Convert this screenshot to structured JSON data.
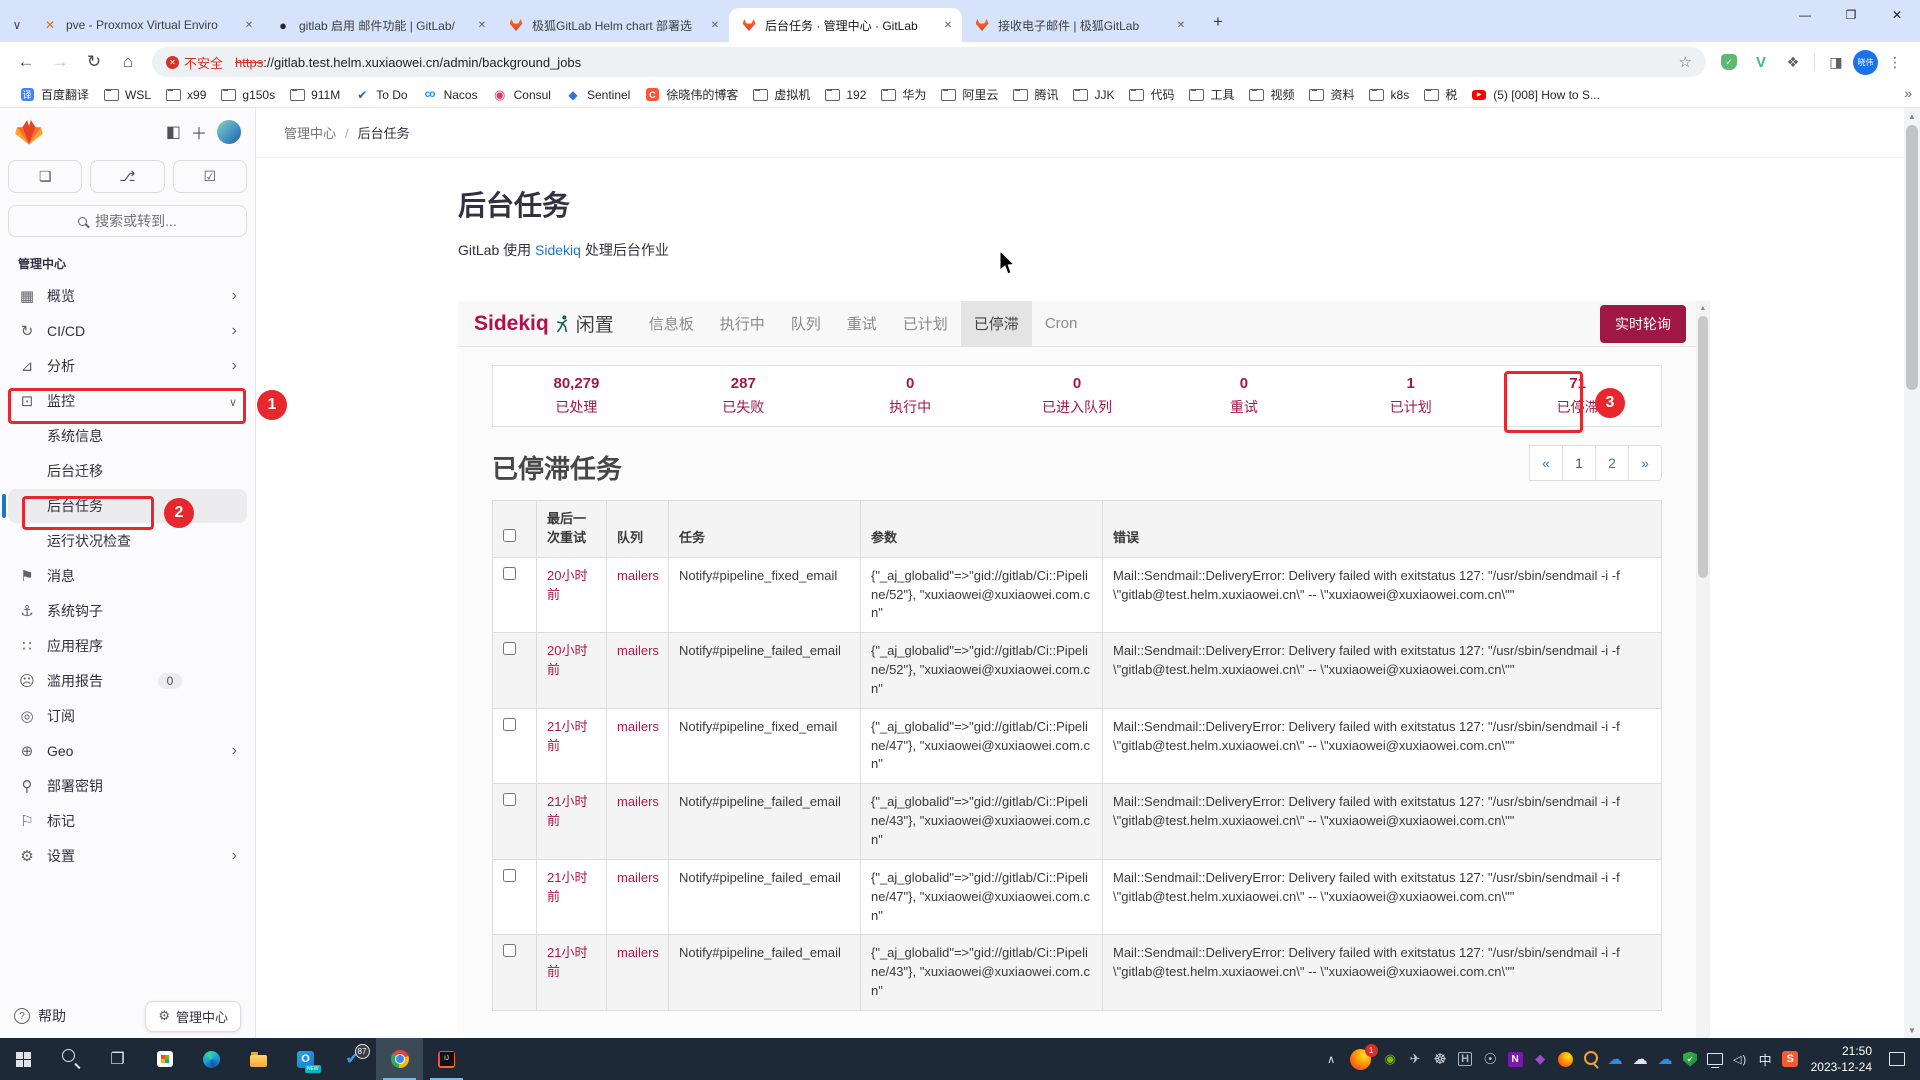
{
  "browser": {
    "tabs": [
      {
        "icon": "proxmox",
        "title": "pve - Proxmox Virtual Enviro"
      },
      {
        "icon": "github",
        "title": "gitlab 启用 邮件功能 | GitLab/"
      },
      {
        "icon": "fox",
        "title": "极狐GitLab Helm chart 部署选"
      },
      {
        "icon": "fox",
        "title": "后台任务 · 管理中心 · GitLab",
        "active": true
      },
      {
        "icon": "fox",
        "title": "接收电子邮件 | 极狐GitLab"
      }
    ],
    "window": {
      "minimize": "—",
      "maximize": "❐",
      "close": "✕"
    },
    "toolbar": {
      "back": "←",
      "forward": "→",
      "reload": "↻",
      "home": "⌂",
      "security_label": "不安全",
      "url_https": "https",
      "url_rest": "://gitlab.test.helm.xuxiaowei.cn/admin/background_jobs",
      "star": "☆",
      "extensions": "❖",
      "kebab": "⋮",
      "avatar_text": "晓伟",
      "vue": "V",
      "side_panel": "◨"
    },
    "bookmarks": [
      {
        "icon": "translate",
        "label": "百度翻译"
      },
      {
        "icon": "folder",
        "label": "WSL"
      },
      {
        "icon": "folder",
        "label": "x99"
      },
      {
        "icon": "folder",
        "label": "g150s"
      },
      {
        "icon": "folder",
        "label": "911M"
      },
      {
        "icon": "todo",
        "label": "To Do"
      },
      {
        "icon": "nacos",
        "label": "Nacos"
      },
      {
        "icon": "consul",
        "label": "Consul"
      },
      {
        "icon": "sentinel",
        "label": "Sentinel"
      },
      {
        "icon": "csdn",
        "label": "徐晓伟的博客"
      },
      {
        "icon": "folder",
        "label": "虚拟机"
      },
      {
        "icon": "folder",
        "label": "192"
      },
      {
        "icon": "folder",
        "label": "华为"
      },
      {
        "icon": "folder",
        "label": "阿里云"
      },
      {
        "icon": "folder",
        "label": "腾讯"
      },
      {
        "icon": "folder",
        "label": "JJK"
      },
      {
        "icon": "folder",
        "label": "代码"
      },
      {
        "icon": "folder",
        "label": "工具"
      },
      {
        "icon": "folder",
        "label": "视频"
      },
      {
        "icon": "folder",
        "label": "资料"
      },
      {
        "icon": "folder",
        "label": "k8s"
      },
      {
        "icon": "folder",
        "label": "税"
      },
      {
        "icon": "youtube",
        "label": "(5) [008] How to S..."
      }
    ],
    "bookmarks_overflow": "»"
  },
  "sidebar": {
    "search_placeholder": "搜索或转到...",
    "section_label": "管理中心",
    "items": [
      {
        "icon": "overview",
        "label": "概览",
        "trailing": "chevron-right"
      },
      {
        "icon": "cicd",
        "label": "CI/CD",
        "trailing": "chevron-right"
      },
      {
        "icon": "analytics",
        "label": "分析",
        "trailing": "chevron-right"
      },
      {
        "icon": "monitoring",
        "label": "监控",
        "trailing": "chevron-down"
      },
      {
        "label": "系统信息",
        "sub": true
      },
      {
        "label": "后台迁移",
        "sub": true
      },
      {
        "label": "后台任务",
        "sub": true,
        "active": true
      },
      {
        "label": "运行状况检查",
        "sub": true
      },
      {
        "icon": "announcements",
        "label": "消息"
      },
      {
        "icon": "hooks",
        "label": "系统钩子"
      },
      {
        "icon": "applications",
        "label": "应用程序"
      },
      {
        "icon": "abuse",
        "label": "滥用报告",
        "badge": "0"
      },
      {
        "icon": "subscription",
        "label": "订阅"
      },
      {
        "icon": "geo",
        "label": "Geo",
        "trailing": "chevron-right"
      },
      {
        "icon": "deploy-keys",
        "label": "部署密钥"
      },
      {
        "icon": "labels",
        "label": "标记"
      },
      {
        "icon": "settings",
        "label": "设置",
        "trailing": "chevron-right"
      }
    ],
    "footer": {
      "help_label": "帮助",
      "admin_pill_label": "管理中心"
    }
  },
  "page": {
    "breadcrumb": [
      {
        "label": "管理中心"
      },
      {
        "label": "后台任务"
      }
    ],
    "title": "后台任务",
    "subtitle_prefix": "GitLab 使用 ",
    "subtitle_link": "Sidekiq",
    "subtitle_suffix": " 处理后台作业"
  },
  "sidekiq": {
    "brand": "Sidekiq",
    "status": "闲置",
    "tabs": [
      {
        "label": "信息板"
      },
      {
        "label": "执行中"
      },
      {
        "label": "队列"
      },
      {
        "label": "重试"
      },
      {
        "label": "已计划"
      },
      {
        "label": "已停滞",
        "active": true
      },
      {
        "label": "Cron"
      }
    ],
    "poll_button": "实时轮询",
    "stats": [
      {
        "value": "80,279",
        "label": "已处理"
      },
      {
        "value": "287",
        "label": "已失败"
      },
      {
        "value": "0",
        "label": "执行中"
      },
      {
        "value": "0",
        "label": "已进入队列"
      },
      {
        "value": "0",
        "label": "重试"
      },
      {
        "value": "1",
        "label": "已计划"
      },
      {
        "value": "71",
        "label": "已停滞"
      }
    ],
    "dead_title": "已停滞任务",
    "pagination": [
      {
        "label": "«"
      },
      {
        "label": "1",
        "current": true
      },
      {
        "label": "2"
      },
      {
        "label": "»"
      }
    ],
    "table": {
      "headers": [
        {
          "label": "最后一次重试"
        },
        {
          "label": "队列"
        },
        {
          "label": "任务"
        },
        {
          "label": "参数"
        },
        {
          "label": "错误"
        }
      ],
      "rows": [
        {
          "retried": "20小时前",
          "queue": "mailers",
          "job": "Notify#pipeline_fixed_email",
          "args": "{\"_aj_globalid\"=>\"gid://gitlab/Ci::Pipeline/52\"}, \"xuxiaowei@xuxiaowei.com.cn\"",
          "error": "Mail::Sendmail::DeliveryError: Delivery failed with exitstatus 127: \"/usr/sbin/sendmail -i -f \\\"gitlab@test.helm.xuxiaowei.cn\\\" -- \\\"xuxiaowei@xuxiaowei.com.cn\\\"\""
        },
        {
          "retried": "20小时前",
          "queue": "mailers",
          "job": "Notify#pipeline_failed_email",
          "args": "{\"_aj_globalid\"=>\"gid://gitlab/Ci::Pipeline/52\"}, \"xuxiaowei@xuxiaowei.com.cn\"",
          "error": "Mail::Sendmail::DeliveryError: Delivery failed with exitstatus 127: \"/usr/sbin/sendmail -i -f \\\"gitlab@test.helm.xuxiaowei.cn\\\" -- \\\"xuxiaowei@xuxiaowei.com.cn\\\"\""
        },
        {
          "retried": "21小时前",
          "queue": "mailers",
          "job": "Notify#pipeline_fixed_email",
          "args": "{\"_aj_globalid\"=>\"gid://gitlab/Ci::Pipeline/47\"}, \"xuxiaowei@xuxiaowei.com.cn\"",
          "error": "Mail::Sendmail::DeliveryError: Delivery failed with exitstatus 127: \"/usr/sbin/sendmail -i -f \\\"gitlab@test.helm.xuxiaowei.cn\\\" -- \\\"xuxiaowei@xuxiaowei.com.cn\\\"\""
        },
        {
          "retried": "21小时前",
          "queue": "mailers",
          "job": "Notify#pipeline_failed_email",
          "args": "{\"_aj_globalid\"=>\"gid://gitlab/Ci::Pipeline/43\"}, \"xuxiaowei@xuxiaowei.com.cn\"",
          "error": "Mail::Sendmail::DeliveryError: Delivery failed with exitstatus 127: \"/usr/sbin/sendmail -i -f \\\"gitlab@test.helm.xuxiaowei.cn\\\" -- \\\"xuxiaowei@xuxiaowei.com.cn\\\"\""
        },
        {
          "retried": "21小时前",
          "queue": "mailers",
          "job": "Notify#pipeline_failed_email",
          "args": "{\"_aj_globalid\"=>\"gid://gitlab/Ci::Pipeline/47\"}, \"xuxiaowei@xuxiaowei.com.cn\"",
          "error": "Mail::Sendmail::DeliveryError: Delivery failed with exitstatus 127: \"/usr/sbin/sendmail -i -f \\\"gitlab@test.helm.xuxiaowei.cn\\\" -- \\\"xuxiaowei@xuxiaowei.com.cn\\\"\""
        },
        {
          "retried": "21小时前",
          "queue": "mailers",
          "job": "Notify#pipeline_failed_email",
          "args": "{\"_aj_globalid\"=>\"gid://gitlab/Ci::Pipeline/43\"}, \"xuxiaowei@xuxiaowei.com.cn\"",
          "error": "Mail::Sendmail::DeliveryError: Delivery failed with exitstatus 127: \"/usr/sbin/sendmail -i -f \\\"gitlab@test.helm.xuxiaowei.cn\\\" -- \\\"xuxiaowei@xuxiaowei.com.cn\\\"\""
        }
      ]
    }
  },
  "annotations": {
    "step1": "1",
    "step2": "2",
    "step3": "3"
  },
  "taskbar": {
    "left": [
      {
        "icon": "start"
      },
      {
        "icon": "search"
      },
      {
        "icon": "task-view"
      },
      {
        "icon": "store"
      },
      {
        "icon": "edge"
      },
      {
        "icon": "explorer"
      },
      {
        "icon": "outlook",
        "badge": "NEW"
      },
      {
        "icon": "todo",
        "badge": "87"
      },
      {
        "icon": "chrome",
        "active": true,
        "running": true
      },
      {
        "icon": "intellij",
        "running": true
      }
    ],
    "tray": [
      {
        "icon": "hidden"
      },
      {
        "icon": "firefox-badge",
        "badge": "1"
      },
      {
        "icon": "nvidia"
      },
      {
        "icon": "telegram"
      },
      {
        "icon": "wheel"
      },
      {
        "icon": "hbeam"
      },
      {
        "icon": "steam"
      },
      {
        "icon": "onenote"
      },
      {
        "icon": "purple-app"
      },
      {
        "icon": "firefox"
      },
      {
        "icon": "search-orange"
      },
      {
        "icon": "onedrive"
      },
      {
        "icon": "cloud-gray"
      },
      {
        "icon": "onedrive2"
      },
      {
        "icon": "defender"
      },
      {
        "icon": "network"
      },
      {
        "icon": "volume"
      },
      {
        "icon": "ime"
      },
      {
        "icon": "sogou"
      }
    ],
    "clock": {
      "time": "21:50",
      "date": "2023-12-24"
    }
  }
}
